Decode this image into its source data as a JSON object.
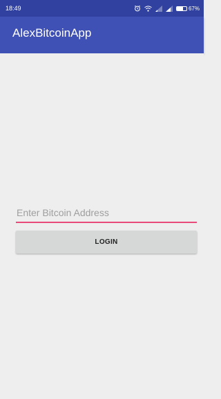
{
  "status_bar": {
    "time": "18:49",
    "battery_text": "67%",
    "battery_level": 0.67,
    "icons": [
      "alarm-icon",
      "wifi-icon",
      "signal-weak-icon",
      "signal-icon",
      "battery-icon"
    ]
  },
  "app_bar": {
    "title": "AlexBitcoinApp"
  },
  "form": {
    "bitcoin_address": {
      "value": "",
      "placeholder": "Enter Bitcoin Address"
    },
    "login_label": "LOGIN"
  },
  "colors": {
    "status_bar": "#3041a0",
    "app_bar": "#3f51b5",
    "accent": "#e84a7a",
    "background": "#eeeeee",
    "button": "#d6d7d7"
  }
}
